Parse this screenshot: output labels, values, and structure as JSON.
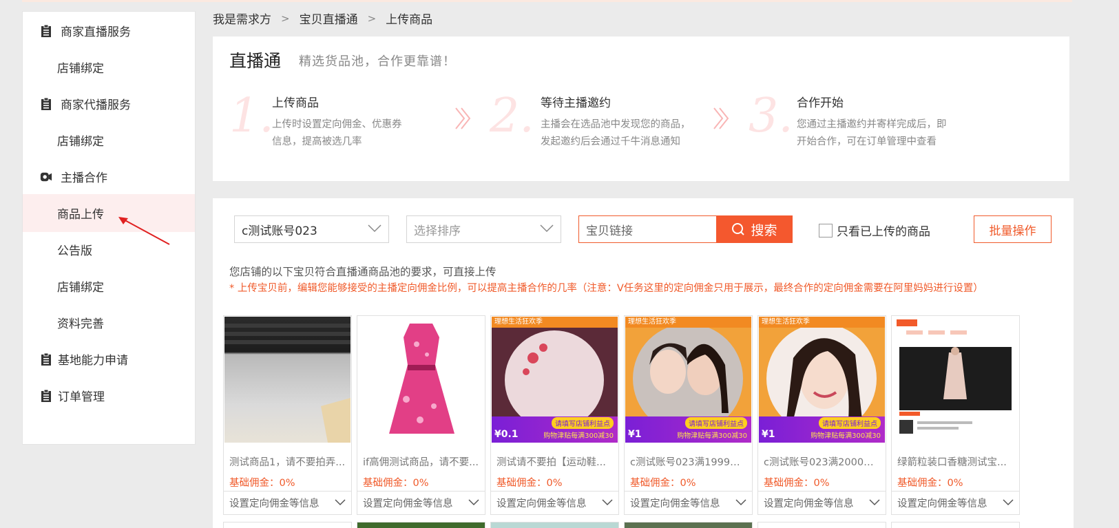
{
  "sidebar": {
    "groups": [
      {
        "label": "商家直播服务",
        "items": [
          "店铺绑定"
        ]
      },
      {
        "label": "商家代播服务",
        "items": [
          "店铺绑定"
        ]
      },
      {
        "label": "主播合作",
        "items": [
          "商品上传",
          "公告版",
          "店铺绑定",
          "资料完善"
        ]
      },
      {
        "label": "基地能力申请"
      },
      {
        "label": "订单管理"
      }
    ],
    "active": "商品上传"
  },
  "breadcrumb": [
    "我是需求方",
    "宝贝直播通",
    "上传商品"
  ],
  "intro": {
    "title": "直播通",
    "subtitle": "精选货品池，合作更靠谱！",
    "steps": [
      {
        "num": "1.",
        "title": "上传商品",
        "desc": "上传时设置定向佣金、优惠券信息，提高被选几率"
      },
      {
        "num": "2.",
        "title": "等待主播邀约",
        "desc": "主播会在选品池中发现您的商品，发起邀约后会通过千牛消息通知"
      },
      {
        "num": "3.",
        "title": "合作开始",
        "desc": "您通过主播邀约并寄样完成后，即开始合作，可在订单管理中查看"
      }
    ]
  },
  "filters": {
    "account_select": "c测试账号023",
    "sort_placeholder": "选择排序",
    "search_placeholder": "宝贝链接",
    "search_button": "搜索",
    "only_uploaded_label": "只看已上传的商品",
    "batch_button": "批量操作"
  },
  "notes": {
    "line1": "您店铺的以下宝贝符合直播通商品池的要求，可直接上传",
    "line2": "* 上传宝贝前，编辑您能够接受的主播定向佣金比例，可以提高主播合作的几率（注意：V任务这里的定向佣金只用于展示，最终合作的定向佣金需要在阿里妈妈进行设置）"
  },
  "products": [
    {
      "title": "测试商品1，请不要拍弄...",
      "commission": "基础佣金：0%",
      "footer": "设置定向佣金等信息"
    },
    {
      "title": "if高佣测试商品，请不要...",
      "commission": "基础佣金：0%",
      "footer": "设置定向佣金等信息"
    },
    {
      "title": "测试请不要拍【运动鞋...",
      "commission": "基础佣金：0%",
      "footer": "设置定向佣金等信息",
      "promo": {
        "top": "理想生活狂欢季",
        "price": "¥0.1",
        "tag1": "请填写店铺利益点",
        "tag2": "购物津贴每满300减30"
      }
    },
    {
      "title": "c测试账号023满1999元-...",
      "commission": "基础佣金：0%",
      "footer": "设置定向佣金等信息",
      "promo": {
        "top": "理想生活狂欢季",
        "price": "¥1",
        "tag1": "请填写店铺利益点",
        "tag2": "购物津贴每满300减30"
      }
    },
    {
      "title": "c测试账号023满2000元-...",
      "commission": "基础佣金：0%",
      "footer": "设置定向佣金等信息",
      "promo": {
        "top": "理想生活狂欢季",
        "price": "¥1",
        "tag1": "请填写店铺利益点",
        "tag2": "购物津贴每满300减30"
      }
    },
    {
      "title": "绿箭粒装口香糖测试宝...",
      "commission": "基础佣金：0%",
      "footer": "设置定向佣金等信息"
    }
  ],
  "colors": {
    "accent": "#f4582e",
    "active_bg": "#fdeeee",
    "step_num": "#fde3e3"
  }
}
